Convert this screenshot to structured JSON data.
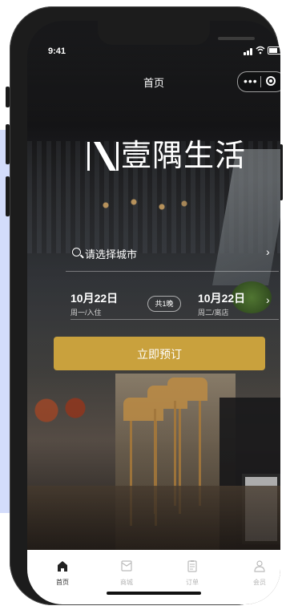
{
  "status": {
    "time": "9:41"
  },
  "nav": {
    "title": "首页",
    "more": "•••"
  },
  "brand": {
    "name": "壹隅生活"
  },
  "search": {
    "city_placeholder": "请选择城市"
  },
  "dates": {
    "checkin": {
      "date": "10月22日",
      "sub": "周一/入住"
    },
    "nights": "共1晚",
    "checkout": {
      "date": "10月22日",
      "sub": "周二/离店"
    }
  },
  "actions": {
    "book": "立即预订"
  },
  "colors": {
    "accent": "#c9a13d"
  },
  "tabbar": [
    {
      "label": "首页",
      "icon": "home-icon",
      "active": true
    },
    {
      "label": "商城",
      "icon": "mail-icon",
      "active": false
    },
    {
      "label": "订单",
      "icon": "clipboard-icon",
      "active": false
    },
    {
      "label": "会员",
      "icon": "user-icon",
      "active": false
    }
  ]
}
